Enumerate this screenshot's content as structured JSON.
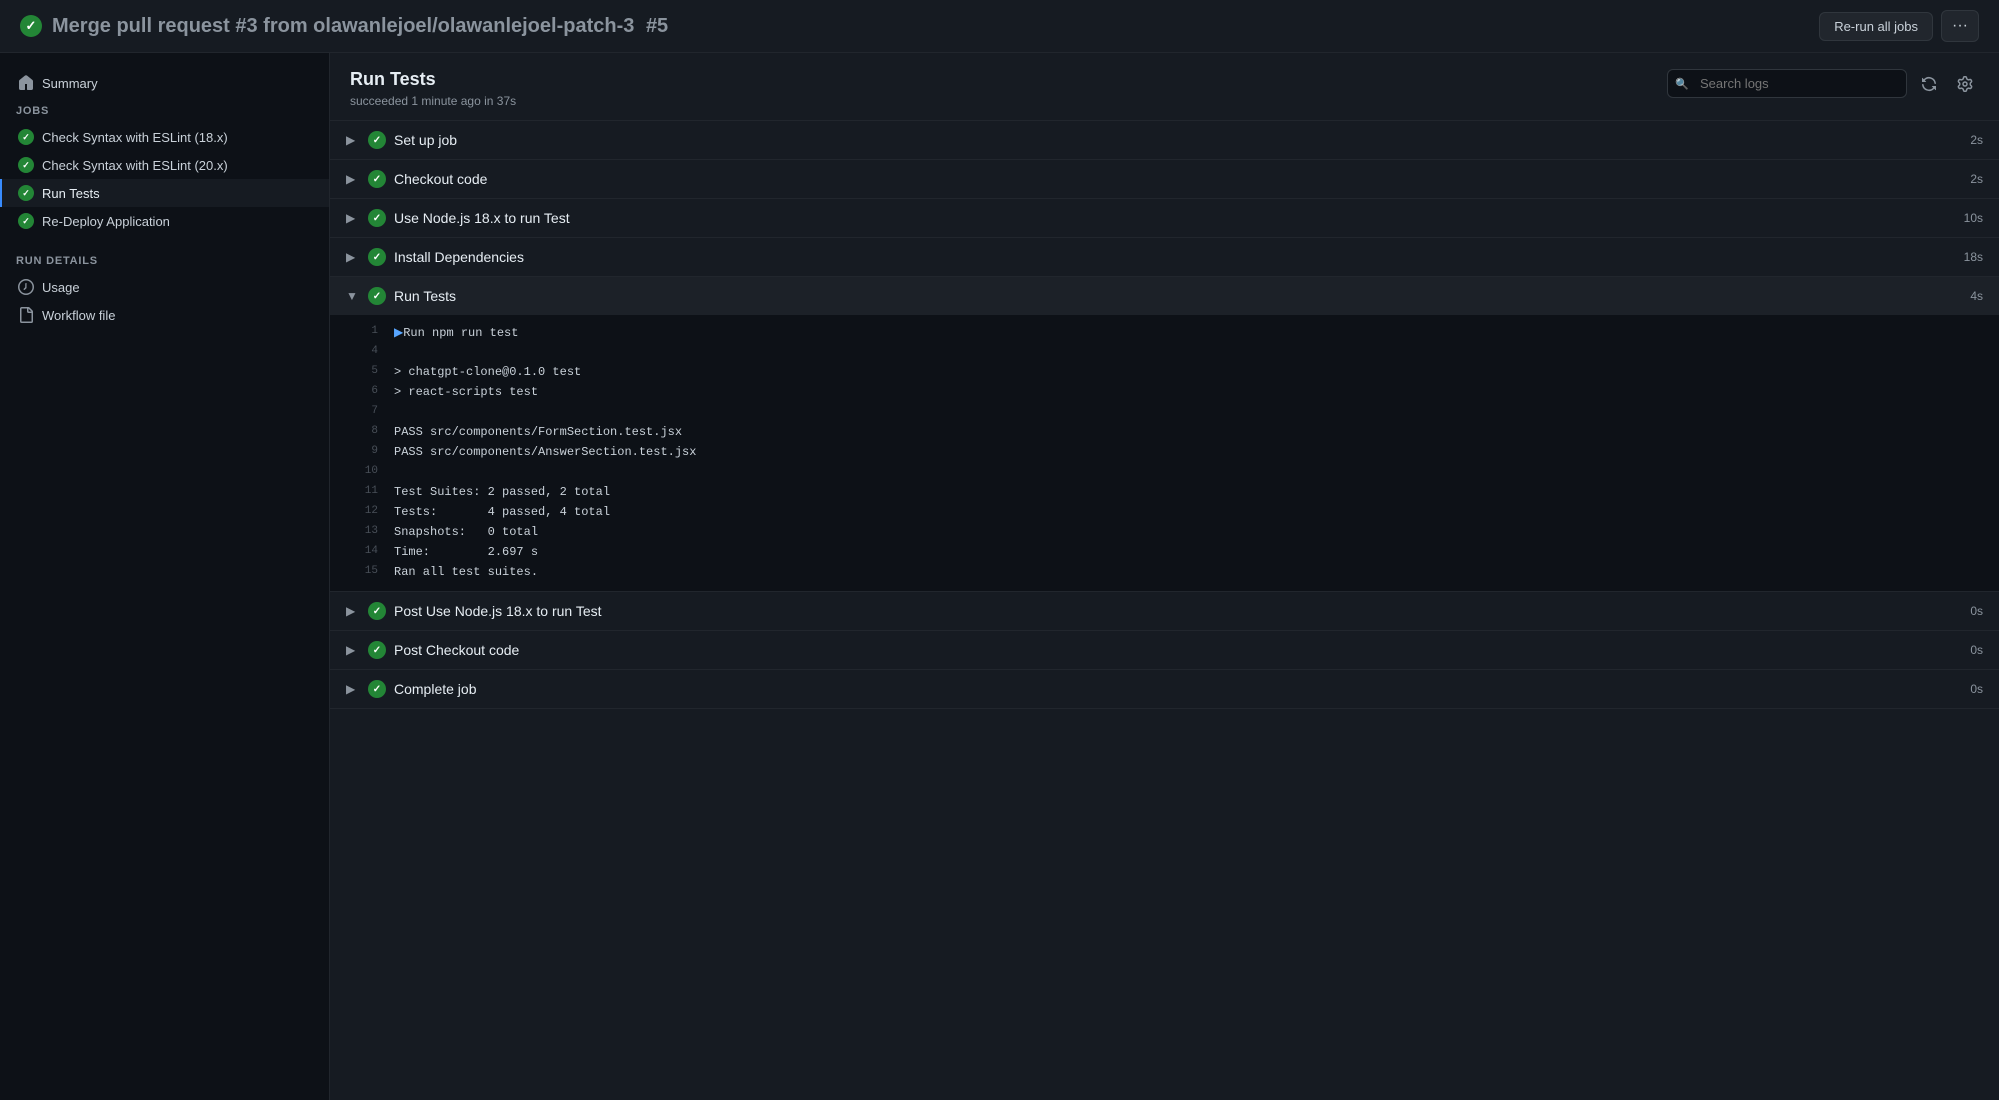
{
  "header": {
    "title": "Merge pull request #3 from olawanlejoel/olawanlejoel-patch-3",
    "run_number": "#5",
    "rerun_label": "Re-run all jobs"
  },
  "sidebar": {
    "summary_label": "Summary",
    "jobs_section_label": "Jobs",
    "jobs": [
      {
        "id": "job-1",
        "label": "Check Syntax with ESLint (18.x)",
        "status": "success"
      },
      {
        "id": "job-2",
        "label": "Check Syntax with ESLint (20.x)",
        "status": "success"
      },
      {
        "id": "job-3",
        "label": "Run Tests",
        "status": "success",
        "active": true
      },
      {
        "id": "job-4",
        "label": "Re-Deploy Application",
        "status": "success"
      }
    ],
    "run_details_label": "Run details",
    "usage_label": "Usage",
    "workflow_file_label": "Workflow file"
  },
  "content": {
    "title": "Run Tests",
    "subtitle": "succeeded 1 minute ago in 37s",
    "search_placeholder": "Search logs",
    "steps": [
      {
        "id": "step-setup",
        "name": "Set up job",
        "duration": "2s",
        "expanded": false
      },
      {
        "id": "step-checkout",
        "name": "Checkout code",
        "duration": "2s",
        "expanded": false
      },
      {
        "id": "step-nodejs",
        "name": "Use Node.js 18.x to run Test",
        "duration": "10s",
        "expanded": false
      },
      {
        "id": "step-install",
        "name": "Install Dependencies",
        "duration": "18s",
        "expanded": false
      },
      {
        "id": "step-run-tests",
        "name": "Run Tests",
        "duration": "4s",
        "expanded": true,
        "log_lines": [
          {
            "num": "1",
            "content": "▶Run npm run test",
            "type": "cmd"
          },
          {
            "num": "4",
            "content": "",
            "type": "normal"
          },
          {
            "num": "5",
            "content": "> chatgpt-clone@0.1.0 test",
            "type": "normal"
          },
          {
            "num": "6",
            "content": "> react-scripts test",
            "type": "normal"
          },
          {
            "num": "7",
            "content": "",
            "type": "normal"
          },
          {
            "num": "8",
            "content": "PASS src/components/FormSection.test.jsx",
            "type": "pass"
          },
          {
            "num": "9",
            "content": "PASS src/components/AnswerSection.test.jsx",
            "type": "pass"
          },
          {
            "num": "10",
            "content": "",
            "type": "normal"
          },
          {
            "num": "11",
            "content": "Test Suites: 2 passed, 2 total",
            "type": "normal"
          },
          {
            "num": "12",
            "content": "Tests:       4 passed, 4 total",
            "type": "normal"
          },
          {
            "num": "13",
            "content": "Snapshots:   0 total",
            "type": "normal"
          },
          {
            "num": "14",
            "content": "Time:        2.697 s",
            "type": "normal"
          },
          {
            "num": "15",
            "content": "Ran all test suites.",
            "type": "normal"
          }
        ]
      },
      {
        "id": "step-post-nodejs",
        "name": "Post Use Node.js 18.x to run Test",
        "duration": "0s",
        "expanded": false
      },
      {
        "id": "step-post-checkout",
        "name": "Post Checkout code",
        "duration": "0s",
        "expanded": false
      },
      {
        "id": "step-complete",
        "name": "Complete job",
        "duration": "0s",
        "expanded": false
      }
    ]
  }
}
